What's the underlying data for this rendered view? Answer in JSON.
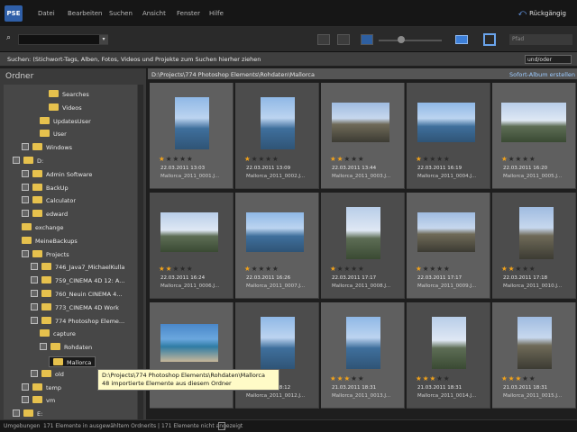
{
  "menu": {
    "logo": "PSE",
    "items": [
      "Datei",
      "Bearbeiten",
      "Suchen",
      "Ansicht",
      "Fenster",
      "Hilfe"
    ],
    "back_label": "Rückgängig"
  },
  "toolbar": {
    "place_placeholder": "Pfad"
  },
  "hint": {
    "text": "Suchen: (Stichwort-Tags, Alben, Fotos, Videos und Projekte zum Suchen hierher ziehen",
    "button": "und/oder"
  },
  "sidebar": {
    "title": "Ordner",
    "tree": [
      {
        "label": "Searches",
        "level": 4,
        "toggle": false
      },
      {
        "label": "Videos",
        "level": 4,
        "toggle": false
      },
      {
        "label": "UpdatesUser",
        "level": 3,
        "toggle": false
      },
      {
        "label": "User",
        "level": 3,
        "toggle": false
      },
      {
        "label": "Windows",
        "level": 1,
        "toggle": true
      },
      {
        "label": "D:",
        "level": 0,
        "toggle": true
      },
      {
        "label": "Admin Software",
        "level": 1,
        "toggle": true
      },
      {
        "label": "BackUp",
        "level": 1,
        "toggle": true
      },
      {
        "label": "Calculator",
        "level": 1,
        "toggle": true
      },
      {
        "label": "edward",
        "level": 1,
        "toggle": true
      },
      {
        "label": "exchange",
        "level": 1,
        "toggle": false
      },
      {
        "label": "MeineBackups",
        "level": 1,
        "toggle": false
      },
      {
        "label": "Projects",
        "level": 1,
        "toggle": true
      },
      {
        "label": "746_Java7_MichaelKulla",
        "level": 2,
        "toggle": true
      },
      {
        "label": "759_CINEMA 4D 12: A...",
        "level": 2,
        "toggle": true
      },
      {
        "label": "760_Neuin CINEMA 4...",
        "level": 2,
        "toggle": true
      },
      {
        "label": "773_CINEMA 4D Work",
        "level": 2,
        "toggle": true
      },
      {
        "label": "774 Photoshop Eleme...",
        "level": 2,
        "toggle": true
      },
      {
        "label": "capture",
        "level": 3,
        "toggle": false
      },
      {
        "label": "Rohdaten",
        "level": 3,
        "toggle": true
      },
      {
        "label": "Mallorca",
        "level": 4,
        "toggle": false,
        "selected": true
      },
      {
        "label": "old",
        "level": 2,
        "toggle": true
      },
      {
        "label": "temp",
        "level": 1,
        "toggle": true
      },
      {
        "label": "vm",
        "level": 1,
        "toggle": true
      },
      {
        "label": "E:",
        "level": 0,
        "toggle": true
      }
    ]
  },
  "tooltip": {
    "line1": "D:\\Projects\\774 Photoshop Elements\\Rohdaten\\Mallorca",
    "line2": "48 importierte Elemente aus diesem Ordner"
  },
  "pathbar": {
    "path": "D:\\Projects\\774 Photoshop Elements\\Rohdaten\\Mallorca",
    "album": "Sofort-Album erstellen"
  },
  "photos": [
    {
      "type": "sea",
      "rating": 1,
      "date": "22.03.2011 13:03",
      "name": "Mallorca_2011_0001.J..."
    },
    {
      "type": "sea",
      "rating": 1,
      "date": "22.03.2011 13:09",
      "name": "Mallorca_2011_0002.J..."
    },
    {
      "type": "rock",
      "rating": 2,
      "date": "22.03.2011 13:44",
      "name": "Mallorca_2011_0003.J..."
    },
    {
      "type": "sea",
      "rating": 1,
      "date": "22.03.2011 16:19",
      "name": "Mallorca_2011_0004.J..."
    },
    {
      "type": "hill",
      "rating": 1,
      "date": "22.03.2011 16:20",
      "name": "Mallorca_2011_0005.J..."
    },
    {
      "type": "hill",
      "rating": 2,
      "date": "22.03.2011 16:24",
      "name": "Mallorca_2011_0006.J..."
    },
    {
      "type": "sea",
      "rating": 1,
      "date": "22.03.2011 16:26",
      "name": "Mallorca_2011_0007.J..."
    },
    {
      "type": "hill",
      "rating": 1,
      "date": "22.03.2011 17:17",
      "name": "Mallorca_2011_0008.J..."
    },
    {
      "type": "rock",
      "rating": 1,
      "date": "22.03.2011 17:17",
      "name": "Mallorca_2011_0009.J..."
    },
    {
      "type": "rock",
      "rating": 2,
      "date": "22.03.2011 17:18",
      "name": "Mallorca_2011_0010.J..."
    },
    {
      "type": "pano",
      "rating": 3,
      "date": "",
      "name": ""
    },
    {
      "type": "sea",
      "rating": 3,
      "date": "21.03.2011 18:12",
      "name": "Mallorca_2011_0012.J..."
    },
    {
      "type": "sea",
      "rating": 3,
      "date": "21.03.2011 18:31",
      "name": "Mallorca_2011_0013.J..."
    },
    {
      "type": "hill",
      "rating": 3,
      "date": "21.03.2011 18:31",
      "name": "Mallorca_2011_0014.J..."
    },
    {
      "type": "rock",
      "rating": 3,
      "date": "21.03.2011 18:31",
      "name": "Mallorca_2011_0015.J..."
    }
  ],
  "status": {
    "left": "Umgebungen",
    "middle": "171 Elemente in ausgewähltem Ordnerits | 171 Elemente nicht angezeigt"
  }
}
